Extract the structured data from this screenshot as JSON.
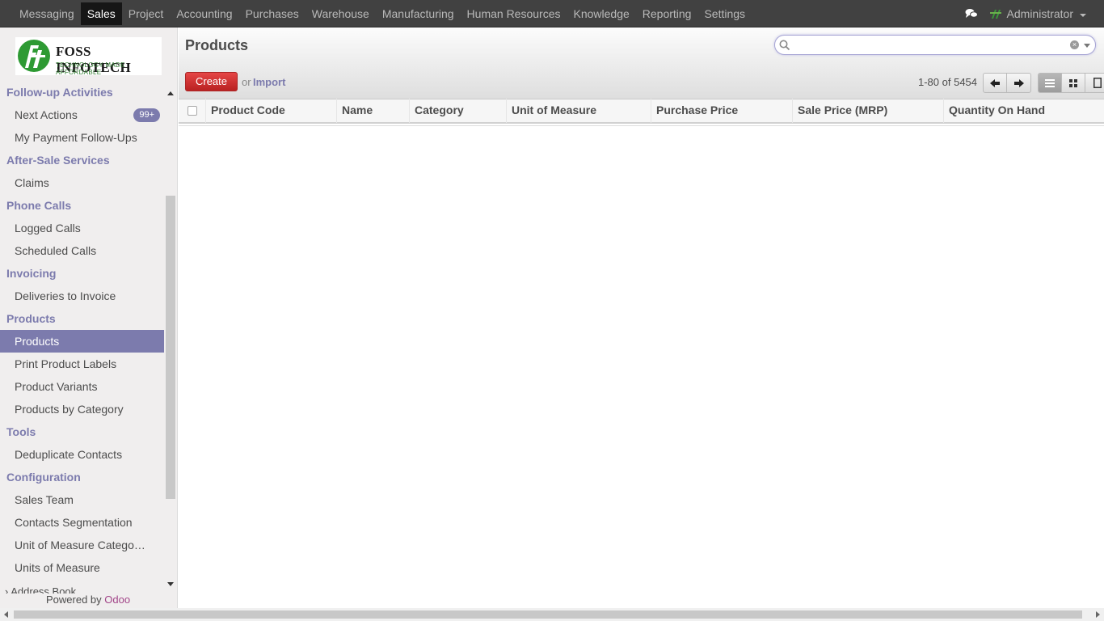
{
  "topbar": {
    "apps": [
      "Messaging",
      "Sales",
      "Project",
      "Accounting",
      "Purchases",
      "Warehouse",
      "Manufacturing",
      "Human Resources",
      "Knowledge",
      "Reporting",
      "Settings"
    ],
    "active_app": "Sales",
    "user": "Administrator"
  },
  "logo": {
    "brand": "FOSS INFOTECH",
    "tagline": "TECHNOLOGY MADE AFFORDABLE"
  },
  "sidebar": {
    "sections": [
      {
        "title": "Follow-up Activities",
        "items": [
          {
            "label": "Next Actions",
            "badge": "99+"
          },
          {
            "label": "My Payment Follow-Ups"
          }
        ]
      },
      {
        "title": "After-Sale Services",
        "items": [
          {
            "label": "Claims"
          }
        ]
      },
      {
        "title": "Phone Calls",
        "items": [
          {
            "label": "Logged Calls"
          },
          {
            "label": "Scheduled Calls"
          }
        ]
      },
      {
        "title": "Invoicing",
        "items": [
          {
            "label": "Deliveries to Invoice"
          }
        ]
      },
      {
        "title": "Products",
        "items": [
          {
            "label": "Products",
            "active": true
          },
          {
            "label": "Print Product Labels"
          },
          {
            "label": "Product Variants"
          },
          {
            "label": "Products by Category"
          }
        ]
      },
      {
        "title": "Tools",
        "items": [
          {
            "label": "Deduplicate Contacts"
          }
        ]
      },
      {
        "title": "Configuration",
        "items": [
          {
            "label": "Sales Team"
          },
          {
            "label": "Contacts Segmentation"
          },
          {
            "label": "Unit of Measure Catego…"
          },
          {
            "label": "Units of Measure"
          }
        ]
      }
    ],
    "address_book": "Address Book",
    "powered_by": "Powered by",
    "powered_brand": "Odoo"
  },
  "main": {
    "title": "Products",
    "search_placeholder": "",
    "create_label": "Create",
    "or_label": "or",
    "import_label": "Import",
    "pager": "1-80 of 5454",
    "columns": [
      "Product Code",
      "Name",
      "Category",
      "Unit of Measure",
      "Purchase Price",
      "Sale Price (MRP)",
      "Quantity On Hand"
    ]
  },
  "colors": {
    "topbar_bg": "#414141",
    "accent": "#7c7bad",
    "create_button": "#dc3c3c",
    "odoo_brand": "#a24689"
  },
  "icons": {
    "chat": "chat-bubbles-icon",
    "search": "magnifier-icon",
    "clear": "clear-circle-icon",
    "prev": "arrow-left-icon",
    "next": "arrow-right-icon",
    "list": "list-view-icon",
    "kanban": "kanban-view-icon",
    "form": "form-view-icon"
  }
}
